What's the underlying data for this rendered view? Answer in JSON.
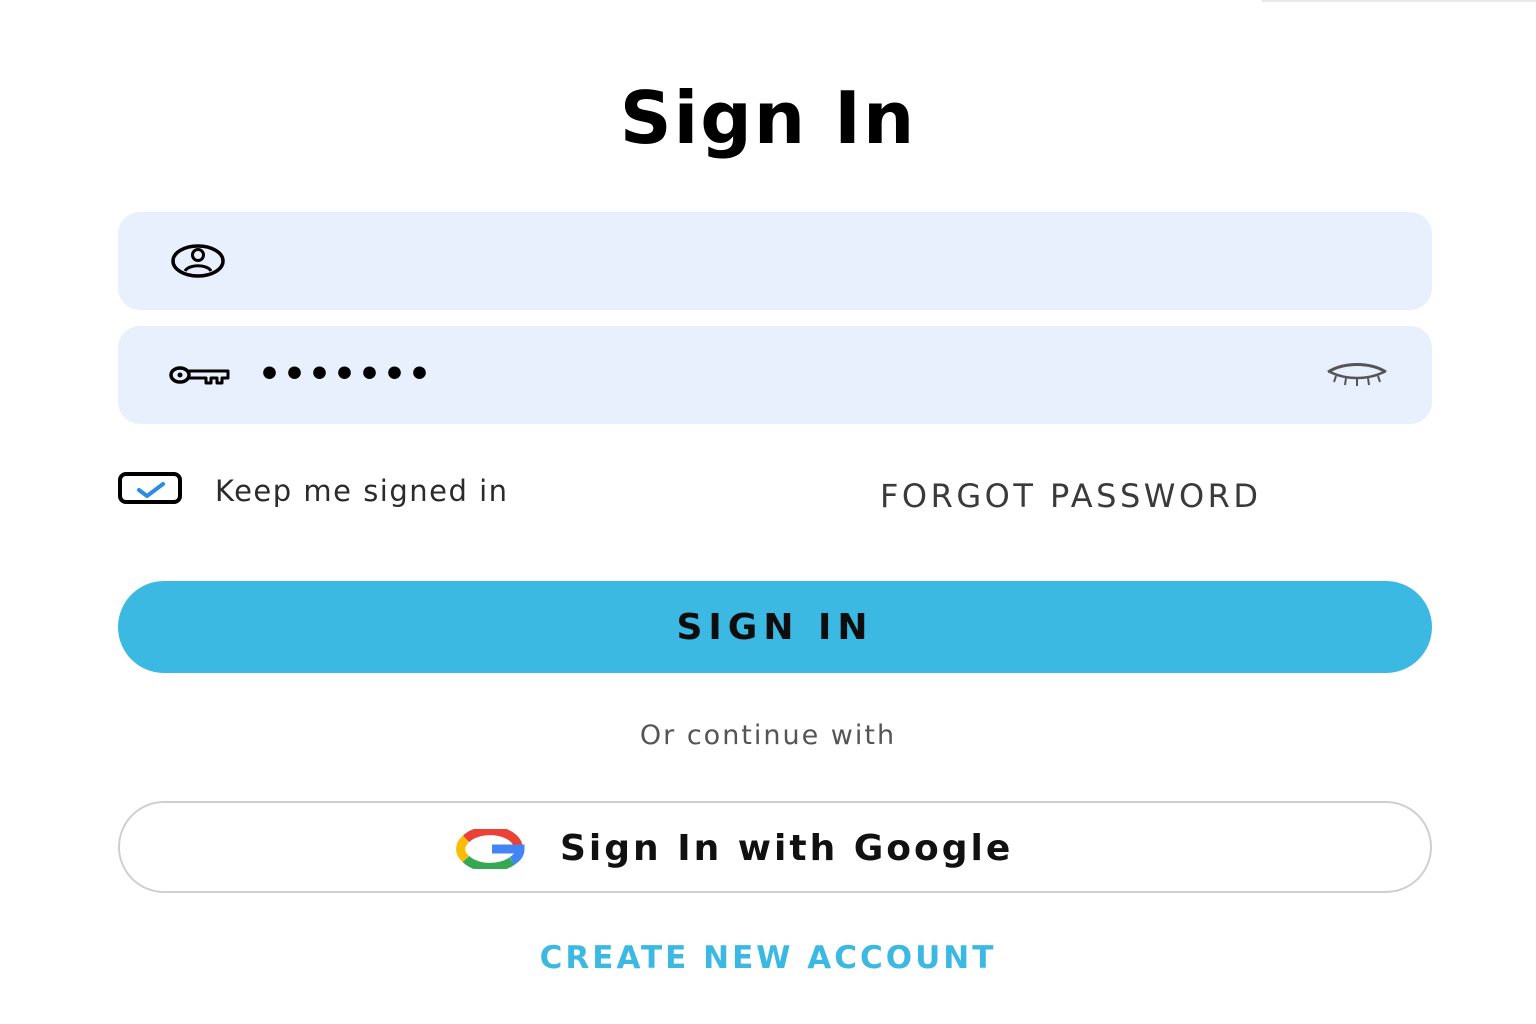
{
  "page": {
    "title": "Sign In"
  },
  "form": {
    "username": {
      "icon": "user-circle-icon",
      "value": "",
      "placeholder": ""
    },
    "password": {
      "icon": "key-icon",
      "masked_value": "•••••••",
      "toggle_icon": "eye-closed-icon"
    },
    "keep_signed_in": {
      "label": "Keep me signed in",
      "checked": true
    },
    "forgot_password_label": "FORGOT PASSWORD",
    "submit_label": "SIGN IN",
    "divider_text": "Or continue with",
    "google": {
      "icon": "google-logo-icon",
      "label": "Sign In with Google"
    },
    "create_account_label": "CREATE NEW ACCOUNT"
  },
  "colors": {
    "field_bg": "#e8f0fe",
    "accent": "#3bb9e3",
    "google_blue": "#4285F4",
    "google_red": "#EA4335",
    "google_yellow": "#FBBC05",
    "google_green": "#34A853"
  }
}
